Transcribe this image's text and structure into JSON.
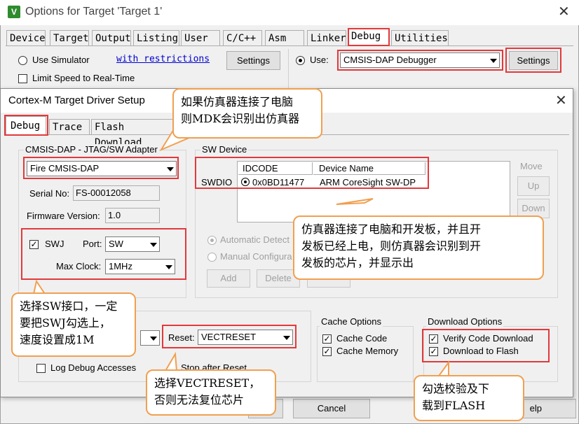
{
  "outer": {
    "title": "Options for Target 'Target 1'",
    "tabs": [
      "Device",
      "Target",
      "Output",
      "Listing",
      "User",
      "C/C++",
      "Asm",
      "Linker",
      "Debug",
      "Utilities"
    ],
    "use_simulator_label": "Use Simulator",
    "restrictions_link": "with restrictions",
    "settings_left": "Settings",
    "limit_speed_label": "Limit Speed to Real-Time",
    "use_label": "Use:",
    "debugger": "CMSIS-DAP Debugger",
    "settings_right": "Settings",
    "cancel": "Cancel",
    "help_partial": "elp"
  },
  "dialog": {
    "title": "Cortex-M Target Driver Setup",
    "tabs": [
      "Debug",
      "Trace",
      "Flash Download"
    ],
    "adapter_group": "CMSIS-DAP - JTAG/SW Adapter",
    "adapter": "Fire CMSIS-DAP",
    "serial_label": "Serial No:",
    "serial_value": "FS-00012058",
    "firmware_label": "Firmware Version:",
    "firmware_value": "1.0",
    "swj_label": "SWJ",
    "port_label": "Port:",
    "port_value": "SW",
    "maxclock_label": "Max Clock:",
    "maxclock_value": "1MHz",
    "swdevice_group": "SW Device",
    "col_idcode": "IDCODE",
    "col_device": "Device Name",
    "row_label": "SWDIO",
    "row_idcode": "0x0BD11477",
    "row_device": "ARM CoreSight SW-DP",
    "move_label": "Move",
    "up": "Up",
    "down": "Down",
    "auto_detect": "Automatic Detect",
    "manual_config": "Manual Configura",
    "add": "Add",
    "delete": "Delete",
    "reset_label": "Reset:",
    "reset_value": "VECTRESET",
    "log_debug": "Log Debug Accesses",
    "stop_after_reset": "Stop after Reset",
    "cache_group": "Cache Options",
    "cache_code": "Cache Code",
    "cache_memory": "Cache Memory",
    "download_group": "Download Options",
    "verify_code": "Verify Code Download",
    "download_flash": "Download to Flash"
  },
  "callouts": {
    "c1": [
      "如果仿真器连接了电脑",
      "则MDK会识别出仿真器"
    ],
    "c2": [
      "仿真器连接了电脑和开发板，并且开",
      "发板已经上电，则仿真器会识别到开",
      "发板的芯片，并显示出"
    ],
    "c3": [
      "选择SW接口，一定",
      "要把SWJ勾选上，",
      "速度设置成1M"
    ],
    "c4": [
      "选择VECTRESET，",
      "否则无法复位芯片"
    ],
    "c5": [
      "勾选校验及下",
      "载到FLASH"
    ]
  },
  "colors": {
    "highlight": "#e2393c",
    "callout_border": "#f0a050"
  }
}
